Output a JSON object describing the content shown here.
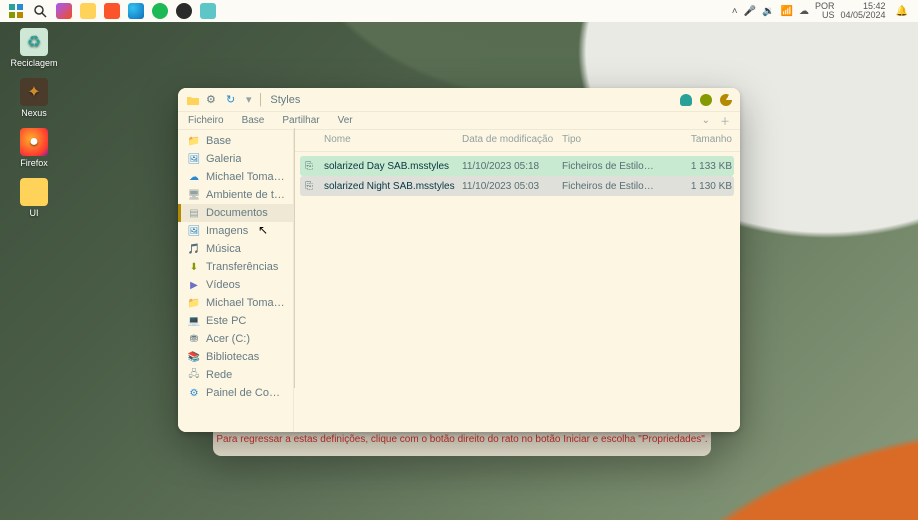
{
  "taskbar": {
    "tray_lang_top": "POR",
    "tray_lang_bot": "US",
    "tray_time": "15:42",
    "tray_date": "04/05/2024"
  },
  "desktop_icons": [
    {
      "label": "Reciclagem",
      "color": "#ffffff",
      "glyph": "♻"
    },
    {
      "label": "Nexus",
      "color": "#ffffff",
      "glyph": "✦"
    },
    {
      "label": "Firefox",
      "color": "#ffffff",
      "glyph": "●"
    },
    {
      "label": "UI",
      "color": "#ffffff",
      "glyph": ""
    }
  ],
  "explorer": {
    "title": "Styles",
    "menus": [
      "Ficheiro",
      "Base",
      "Partilhar",
      "Ver"
    ],
    "columns": {
      "name": "Nome",
      "date": "Data de modificação",
      "type": "Tipo",
      "size": "Tamanho"
    },
    "sidebar": [
      {
        "label": "Base",
        "icon": "folder",
        "color": "#dc322f"
      },
      {
        "label": "Galeria",
        "icon": "image",
        "color": "#268bd2"
      },
      {
        "label": "Michael Tomas - Pess…",
        "icon": "cloud",
        "color": "#268bd2"
      },
      {
        "label": "Ambiente de trabalh…",
        "icon": "desktop",
        "color": "#93a1a1"
      },
      {
        "label": "Documentos",
        "icon": "doc",
        "color": "#93a1a1",
        "selected": true
      },
      {
        "label": "Imagens",
        "icon": "image",
        "color": "#268bd2"
      },
      {
        "label": "Música",
        "icon": "music",
        "color": "#6c71c4"
      },
      {
        "label": "Transferências",
        "icon": "download",
        "color": "#859900"
      },
      {
        "label": "Vídeos",
        "icon": "video",
        "color": "#6c71c4"
      },
      {
        "label": "Michael Tomas Muan…",
        "icon": "folder",
        "color": "#b58900"
      },
      {
        "label": "Este PC",
        "icon": "pc",
        "color": "#93a1a1"
      },
      {
        "label": "Acer (C:)",
        "icon": "drive",
        "color": "#657b83"
      },
      {
        "label": "Bibliotecas",
        "icon": "lib",
        "color": "#b58900"
      },
      {
        "label": "Rede",
        "icon": "net",
        "color": "#93a1a1"
      },
      {
        "label": "Painel de Controlo",
        "icon": "panel",
        "color": "#268bd2"
      }
    ],
    "rows": [
      {
        "name": "solarized Day SAB.msstyles",
        "date": "11/10/2023 05:18",
        "type": "Ficheiros de Estilo…",
        "size": "1 133 KB",
        "sel": "sel1"
      },
      {
        "name": "solarized Night SAB.msstyles",
        "date": "11/10/2023 05:03",
        "type": "Ficheiros de Estilo…",
        "size": "1 130 KB",
        "sel": "sel2"
      }
    ]
  },
  "hint": "Para regressar a estas definições, clique com o botão direito do rato no botão Iniciar e escolha \"Propriedades\"."
}
